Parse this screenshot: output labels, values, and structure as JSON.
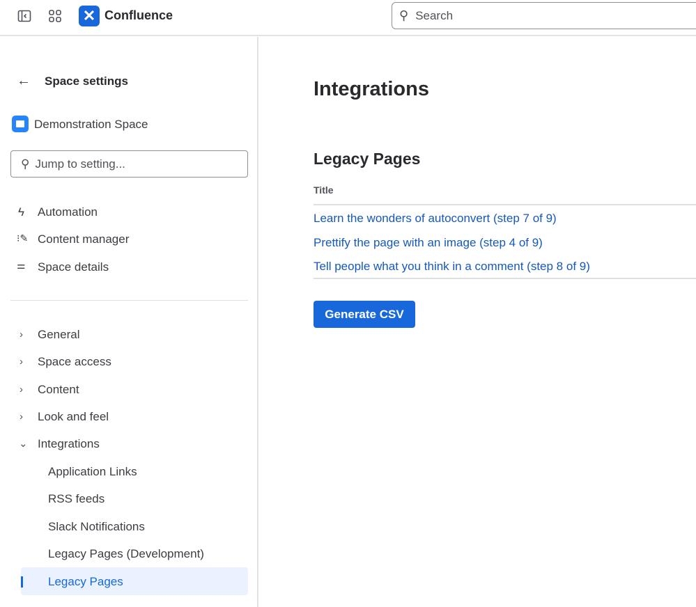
{
  "header": {
    "brand": "Confluence",
    "search_placeholder": "Search"
  },
  "sidebar": {
    "back_label": "Space settings",
    "space_name": "Demonstration Space",
    "jump_placeholder": "Jump to setting...",
    "quick": [
      {
        "label": "Automation"
      },
      {
        "label": "Content manager"
      },
      {
        "label": "Space details"
      }
    ],
    "groups": [
      {
        "label": "General"
      },
      {
        "label": "Space access"
      },
      {
        "label": "Content"
      },
      {
        "label": "Look and feel"
      },
      {
        "label": "Integrations"
      }
    ],
    "integrations": [
      {
        "label": "Application Links"
      },
      {
        "label": "RSS feeds"
      },
      {
        "label": "Slack Notifications"
      },
      {
        "label": "Legacy Pages (Development)"
      },
      {
        "label": "Legacy Pages"
      }
    ]
  },
  "main": {
    "title": "Integrations",
    "section_title": "Legacy Pages",
    "column_header": "Title",
    "rows": [
      {
        "title": "Learn the wonders of autoconvert (step 7 of 9)"
      },
      {
        "title": "Prettify the page with an image (step 4 of 9)"
      },
      {
        "title": "Tell people what you think in a comment (step 8 of 9)"
      }
    ],
    "generate_label": "Generate CSV"
  }
}
